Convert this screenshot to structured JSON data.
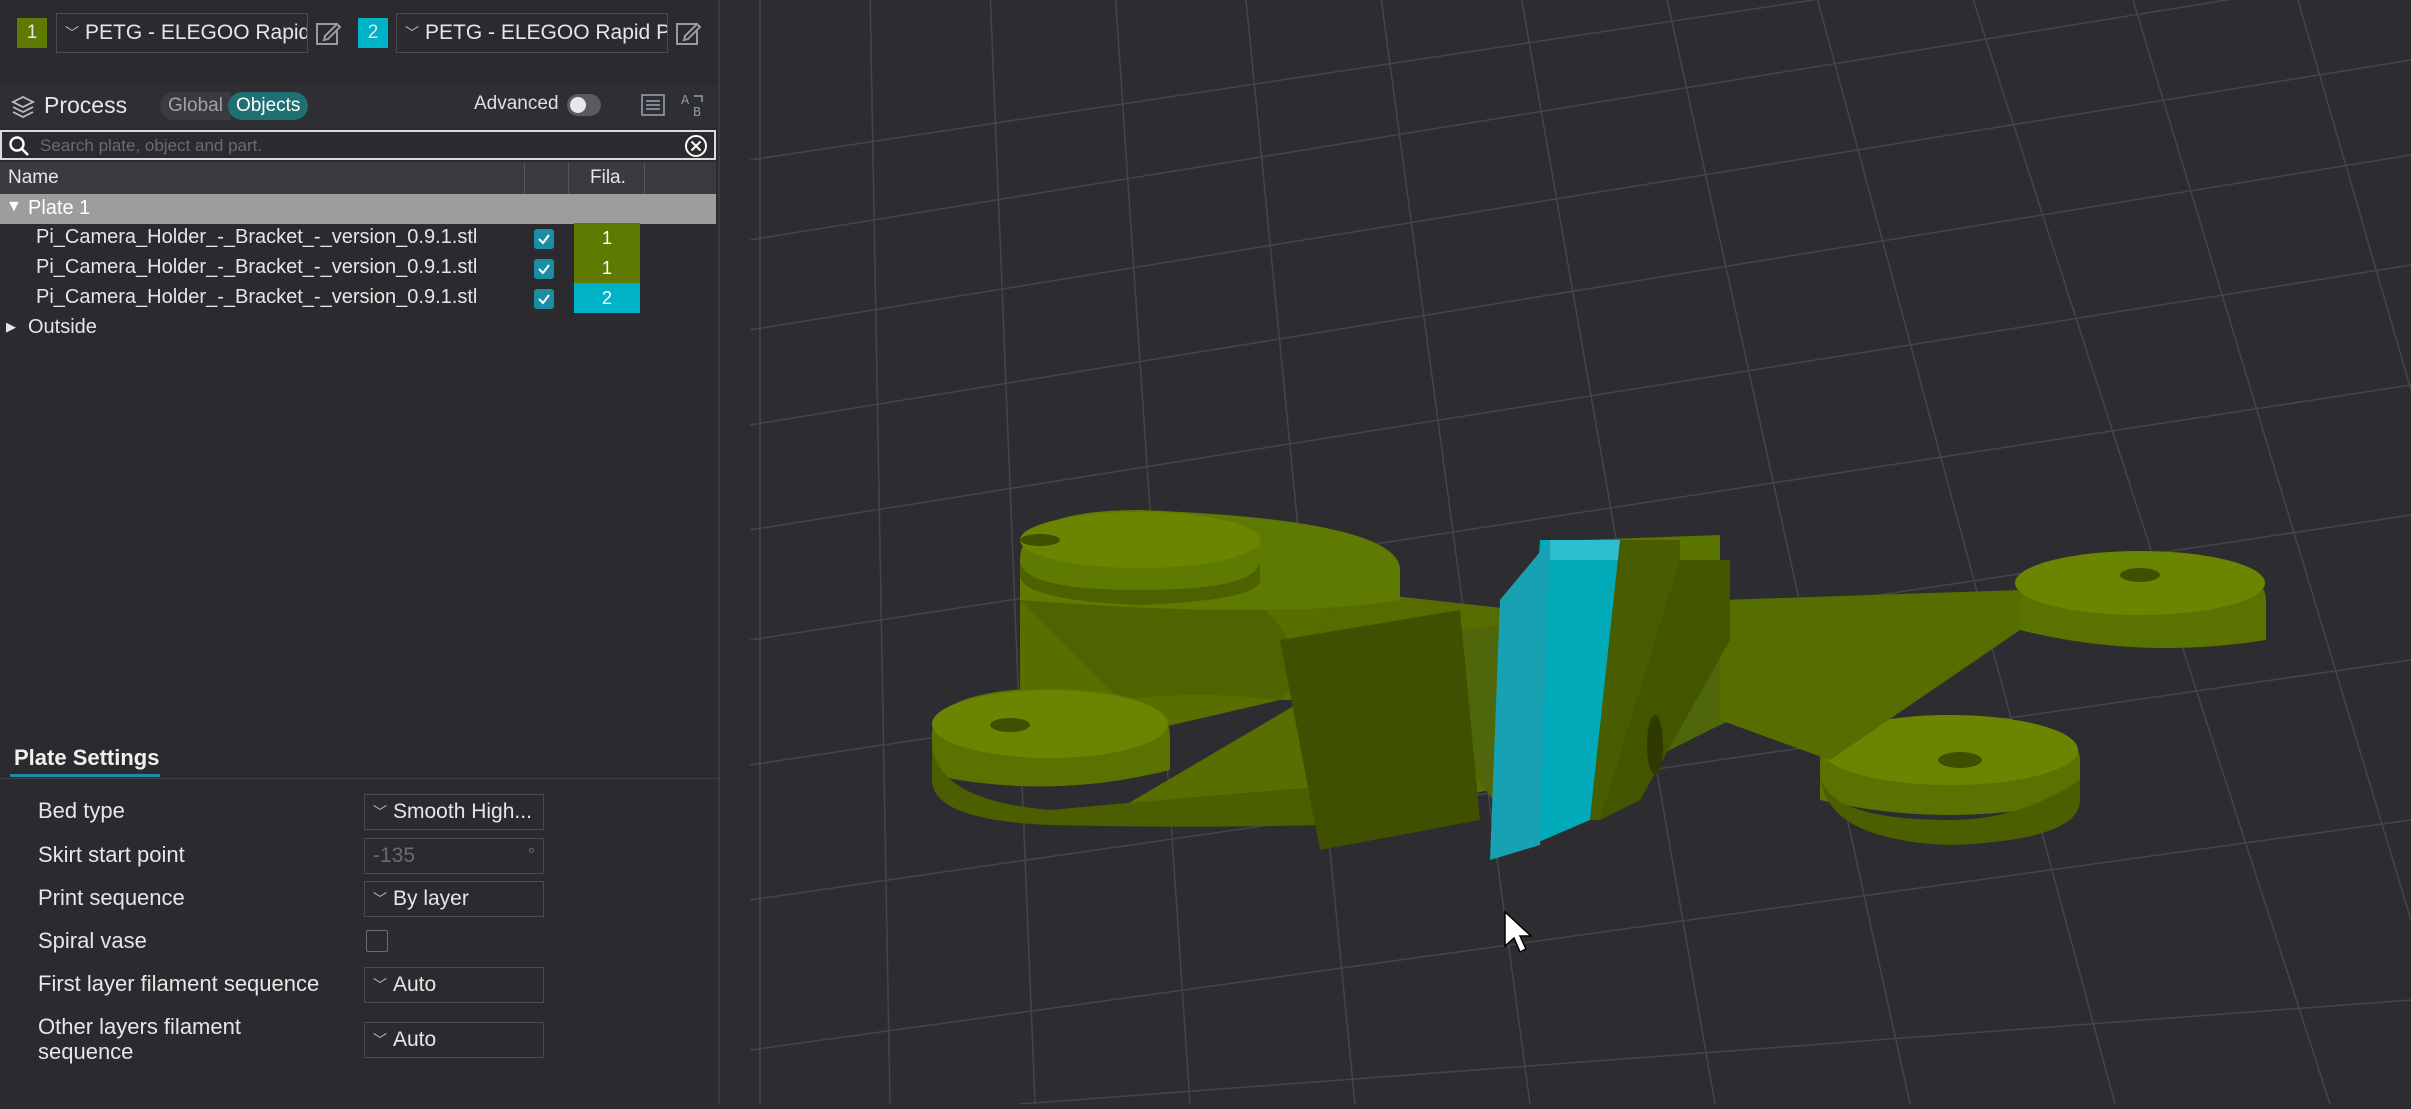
{
  "filaments": [
    {
      "number": "1",
      "color": "#5f7a00",
      "name": "PETG - ELEGOO Rapid..."
    },
    {
      "number": "2",
      "color": "#00b2c8",
      "name": "PETG - ELEGOO Rapid P..."
    }
  ],
  "process": {
    "title": "Process",
    "mode_global": "Global",
    "mode_objects": "Objects",
    "advanced_label": "Advanced",
    "advanced_on": false
  },
  "search": {
    "placeholder": "Search plate, object and part."
  },
  "table": {
    "col_name": "Name",
    "col_fila": "Fila.",
    "plate": "Plate 1",
    "objects": [
      {
        "name": "Pi_Camera_Holder_-_Bracket_-_version_0.9.1.stl",
        "filament": "1",
        "color": "#5f7a00"
      },
      {
        "name": "Pi_Camera_Holder_-_Bracket_-_version_0.9.1.stl",
        "filament": "1",
        "color": "#5f7a00"
      },
      {
        "name": "Pi_Camera_Holder_-_Bracket_-_version_0.9.1.stl",
        "filament": "2",
        "color": "#00b2c8"
      }
    ],
    "outside": "Outside"
  },
  "plate_settings": {
    "title": "Plate Settings",
    "bed_type_label": "Bed type",
    "bed_type_value": "Smooth High...",
    "skirt_label": "Skirt start point",
    "skirt_value": "-135",
    "skirt_unit": "°",
    "print_seq_label": "Print sequence",
    "print_seq_value": "By layer",
    "spiral_label": "Spiral vase",
    "first_layer_label": "First layer filament sequence",
    "first_layer_value": "Auto",
    "other_layers_label_1": "Other layers filament",
    "other_layers_label_2": "sequence",
    "other_layers_value": "Auto"
  },
  "colors": {
    "accent": "#1c8ea3",
    "filament_1": "#5f7a00",
    "filament_2": "#00b2c8"
  }
}
